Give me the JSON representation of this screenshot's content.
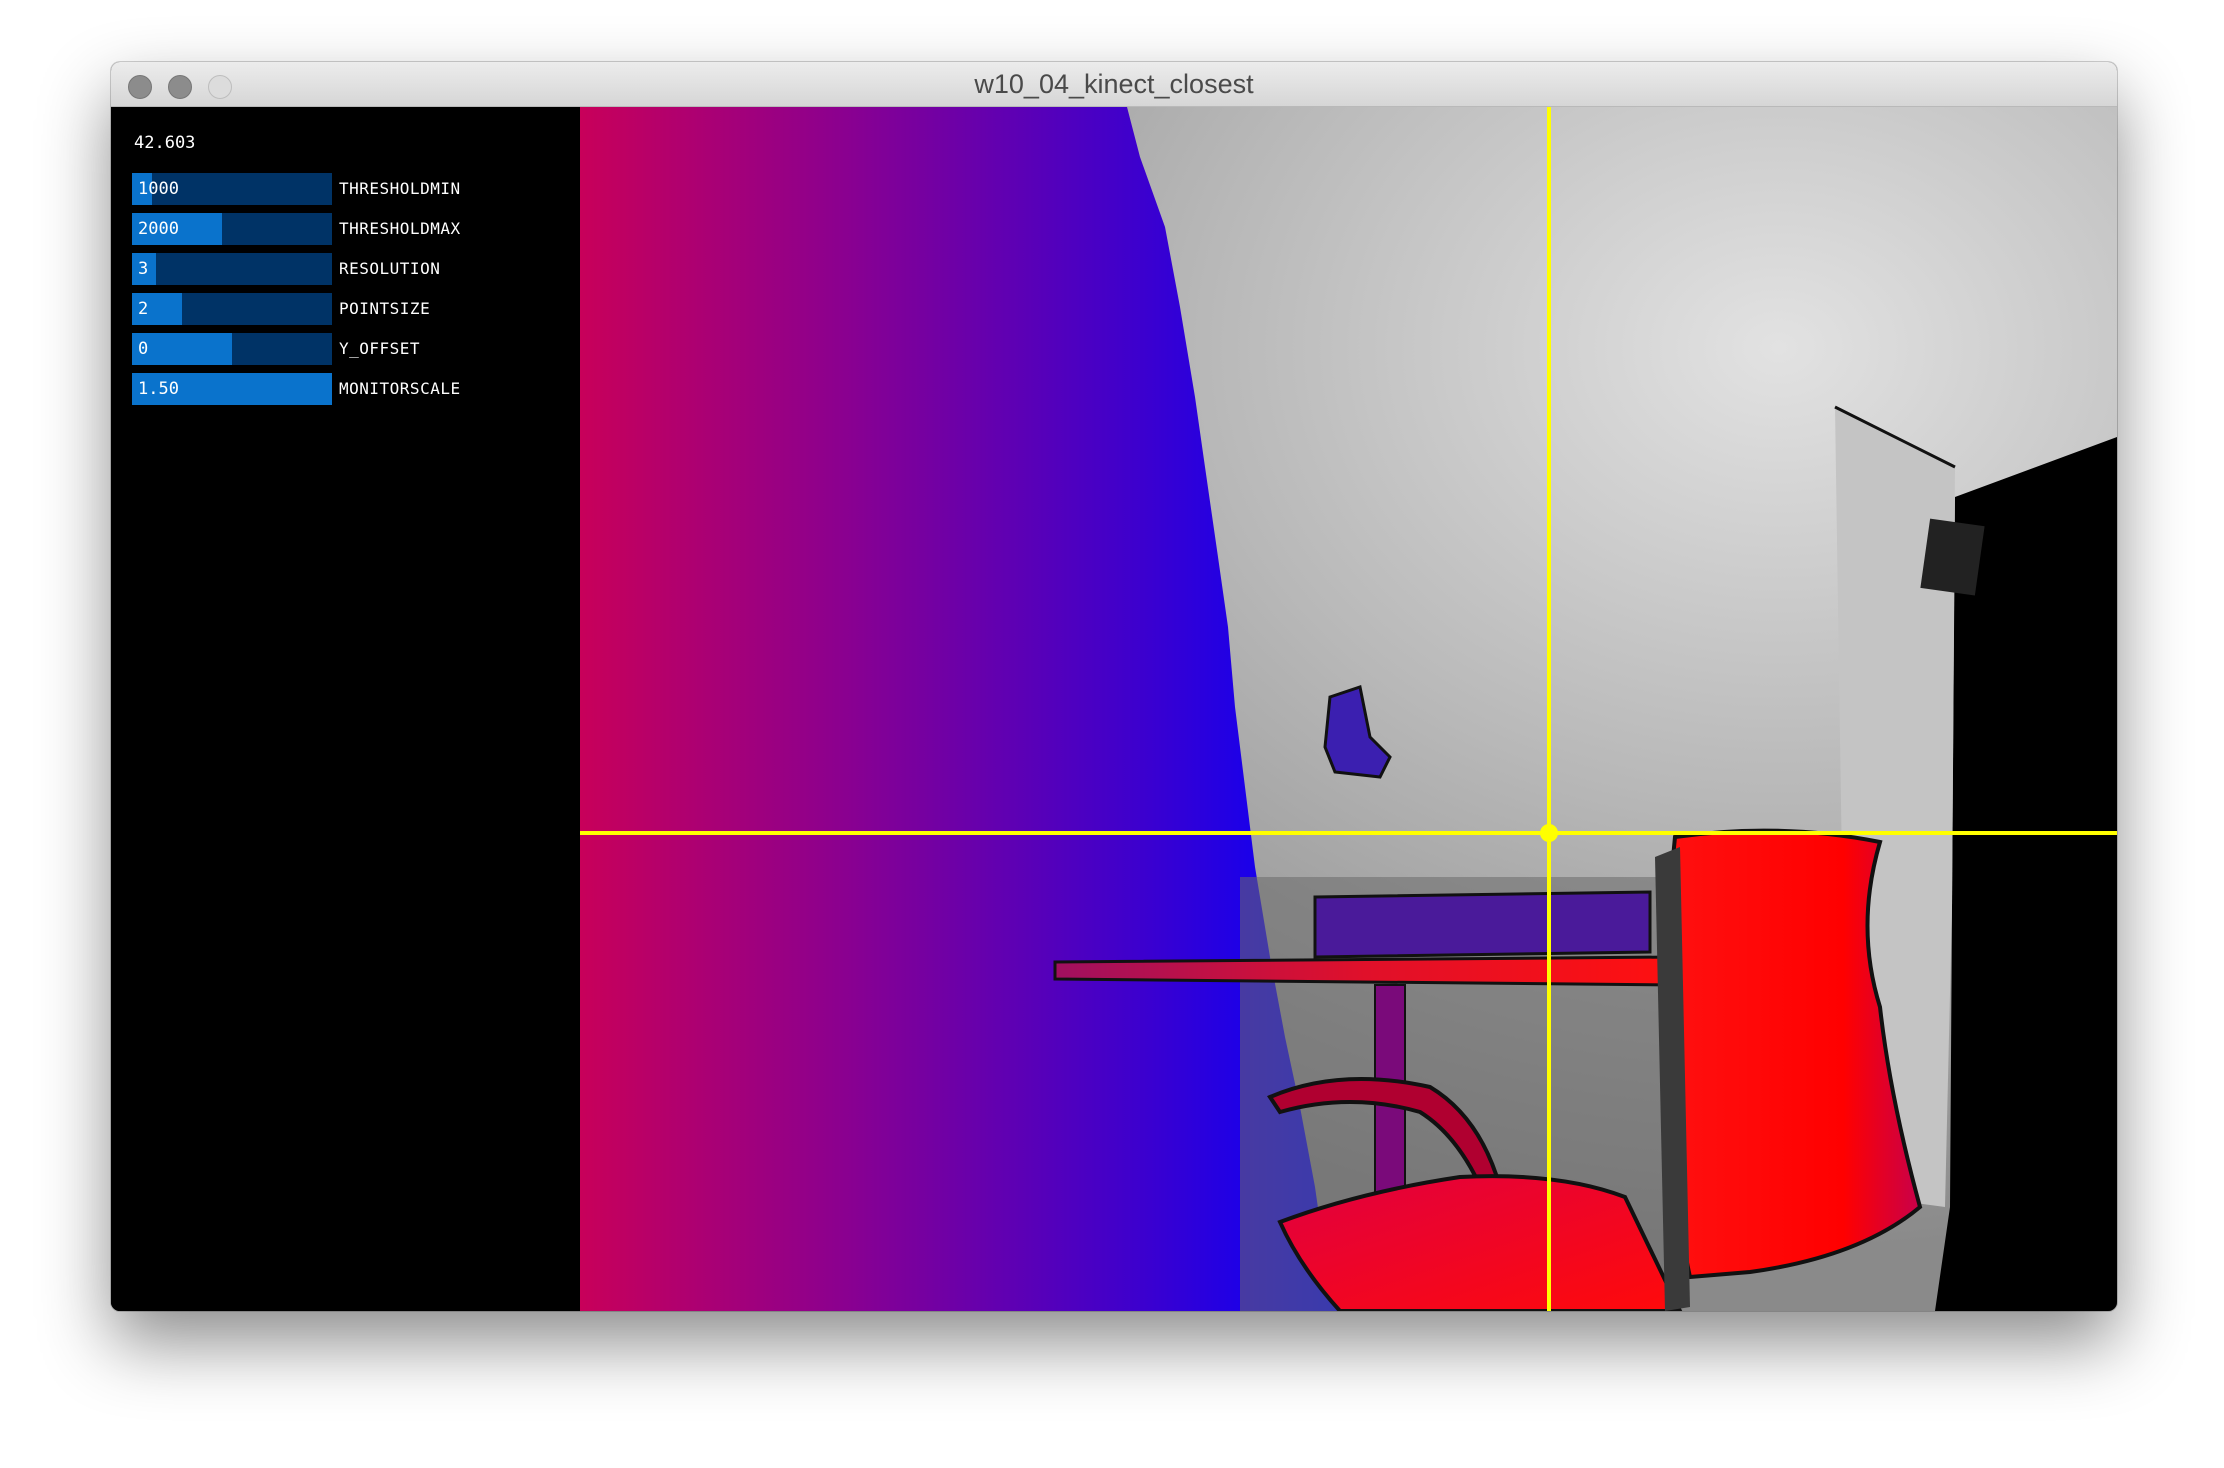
{
  "window": {
    "title": "w10_04_kinect_closest"
  },
  "gui": {
    "fps": "42.603",
    "sliders": [
      {
        "label": "THRESHOLDMIN",
        "value": "1000",
        "fill": 0.1
      },
      {
        "label": "THRESHOLDMAX",
        "value": "2000",
        "fill": 0.45
      },
      {
        "label": "RESOLUTION",
        "value": "3",
        "fill": 0.12
      },
      {
        "label": "POINTSIZE",
        "value": "2",
        "fill": 0.25
      },
      {
        "label": "Y_OFFSET",
        "value": "0",
        "fill": 0.5
      },
      {
        "label": "MONITORSCALE",
        "value": "1.50",
        "fill": 1.0
      }
    ]
  },
  "view": {
    "crosshair_color": "#ffff00",
    "near_color": "#ff0000",
    "far_color": "#0000ff"
  }
}
